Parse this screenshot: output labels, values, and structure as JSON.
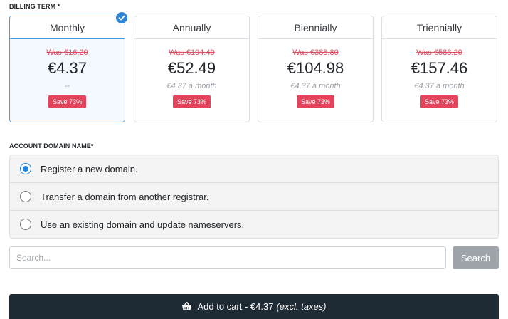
{
  "billing": {
    "label": "BILLING TERM *",
    "terms": [
      {
        "name": "Monthly",
        "was": "Was €16.20",
        "price": "€4.37",
        "monthly": "--",
        "save": "Save 73%",
        "selected": true
      },
      {
        "name": "Annually",
        "was": "Was €194.40",
        "price": "€52.49",
        "monthly": "€4.37 a month",
        "save": "Save 73%",
        "selected": false
      },
      {
        "name": "Biennially",
        "was": "Was €388.80",
        "price": "€104.98",
        "monthly": "€4.37 a month",
        "save": "Save 73%",
        "selected": false
      },
      {
        "name": "Triennially",
        "was": "Was €583.20",
        "price": "€157.46",
        "monthly": "€4.37 a month",
        "save": "Save 73%",
        "selected": false
      }
    ]
  },
  "domain": {
    "label": "ACCOUNT DOMAIN NAME*",
    "options": [
      {
        "label": "Register a new domain.",
        "checked": true
      },
      {
        "label": "Transfer a domain from another registrar.",
        "checked": false
      },
      {
        "label": "Use an existing domain and update nameservers.",
        "checked": false
      }
    ]
  },
  "search": {
    "placeholder": "Search...",
    "button": "Search"
  },
  "cart": {
    "label": "Add to cart - €4.37",
    "tax": "(excl. taxes)"
  },
  "colors": {
    "accent": "#2f86d6",
    "save_badge": "#e3445c",
    "cart_button": "#1e2a34"
  }
}
